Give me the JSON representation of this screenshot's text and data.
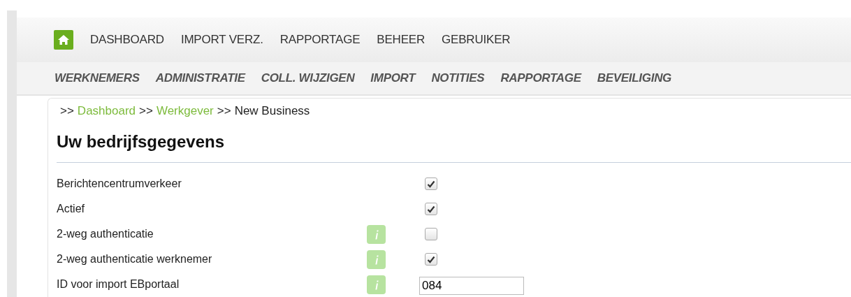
{
  "main_nav": [
    {
      "label": "DASHBOARD"
    },
    {
      "label": "IMPORT VERZ."
    },
    {
      "label": "RAPPORTAGE"
    },
    {
      "label": "BEHEER"
    },
    {
      "label": "GEBRUIKER"
    }
  ],
  "sub_nav": [
    {
      "label": "WERKNEMERS"
    },
    {
      "label": "ADMINISTRATIE"
    },
    {
      "label": "COLL. WIJZIGEN"
    },
    {
      "label": "IMPORT"
    },
    {
      "label": "NOTITIES"
    },
    {
      "label": "RAPPORTAGE"
    },
    {
      "label": "BEVEILIGING"
    }
  ],
  "breadcrumb": [
    {
      "separator": ">>",
      "label": "Dashboard",
      "link": true
    },
    {
      "separator": ">>",
      "label": "Werkgever",
      "link": true
    },
    {
      "separator": ">>",
      "label": "New Business",
      "link": false
    }
  ],
  "heading": "Uw bedrijfsgegevens",
  "fields": [
    {
      "kind": "checkbox",
      "label": "Berichtencentrumverkeer",
      "info": false,
      "checked": true
    },
    {
      "kind": "checkbox",
      "label": "Actief",
      "info": false,
      "checked": true
    },
    {
      "kind": "checkbox",
      "label": "2-weg authenticatie",
      "info": true,
      "checked": false
    },
    {
      "kind": "checkbox",
      "label": "2-weg authenticatie werknemer",
      "info": true,
      "checked": true
    },
    {
      "kind": "text",
      "label": "ID voor import EBportaal",
      "info": true,
      "value": "084"
    }
  ]
}
